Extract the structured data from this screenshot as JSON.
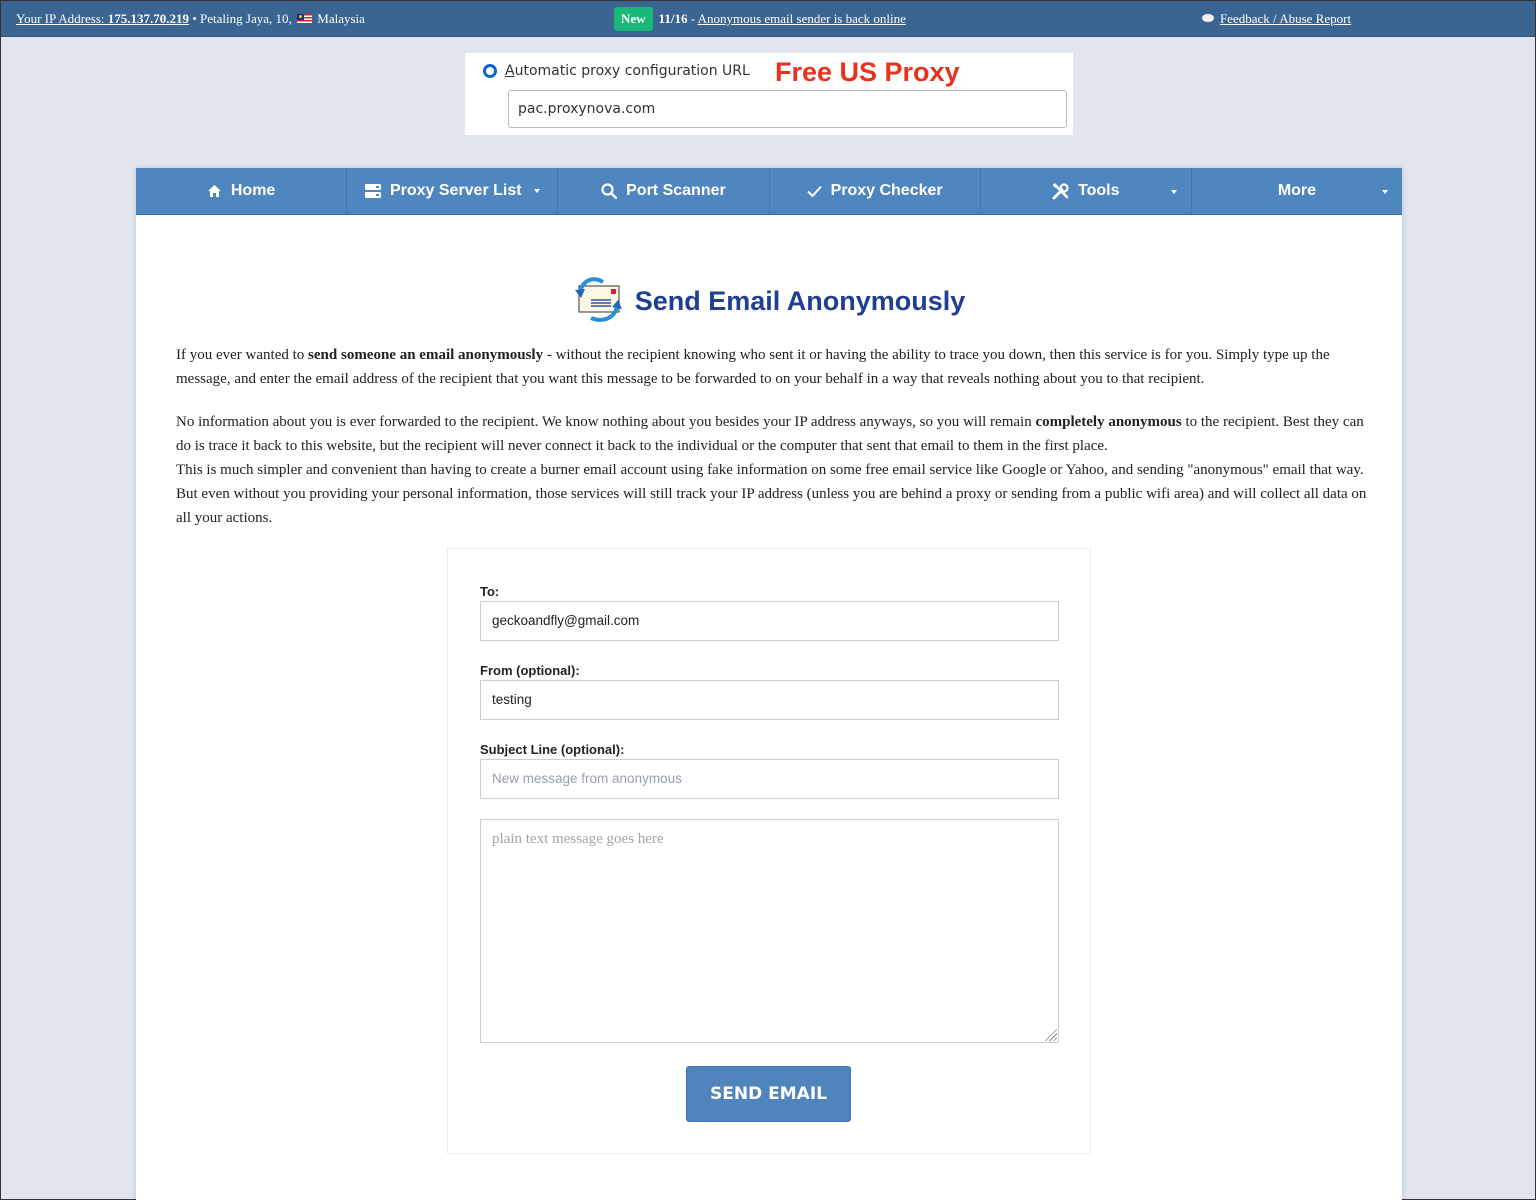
{
  "topbar": {
    "ip_label": "Your IP Address: ",
    "ip_value": "175.137.70.219",
    "location_prefix": " • Petaling Jaya, 10, ",
    "country": "Malaysia",
    "news_badge": "New",
    "news_date": "11/16",
    "news_separator": " - ",
    "news_link": "Anonymous email sender is back online",
    "feedback_link": "Feedback / Abuse Report"
  },
  "ad": {
    "radio_label_first": "A",
    "radio_label_rest": "utomatic proxy configuration URL",
    "promo_text": "Free US Proxy",
    "pac_url": "pac.proxynova.com"
  },
  "nav": {
    "items": [
      {
        "label": "Home",
        "icon": "home-icon"
      },
      {
        "label": "Proxy Server List",
        "icon": "server-icon",
        "dropdown": true
      },
      {
        "label": "Port Scanner",
        "icon": "search-icon"
      },
      {
        "label": "Proxy Checker",
        "icon": "check-icon"
      },
      {
        "label": "Tools",
        "icon": "tools-icon",
        "dropdown": true
      },
      {
        "label": "More",
        "dropdown": true
      }
    ]
  },
  "page": {
    "title": "Send Email Anonymously",
    "intro": {
      "p1_a": "If you ever wanted to ",
      "p1_bold": "send someone an email anonymously",
      "p1_b": " - without the recipient knowing who sent it or having the ability to trace you down, then this service is for you. Simply type up the message, and enter the email address of the recipient that you want this message to be forwarded to on your behalf in a way that reveals nothing about you to that recipient.",
      "p2_a": "No information about you is ever forwarded to the recipient. We know nothing about you besides your IP address anyways, so you will remain ",
      "p2_bold": "completely anonymous",
      "p2_b": " to the recipient. Best they can do is trace it back to this website, but the recipient will never connect it back to the individual or the computer that sent that email to them in the first place.",
      "p3": "This is much simpler and convenient than having to create a burner email account using fake information on some free email service like Google or Yahoo, and sending \"anonymous\" email that way. But even without you providing your personal information, those services will still track your IP address (unless you are behind a proxy or sending from a public wifi area) and will collect all data on all your actions."
    }
  },
  "form": {
    "to_label": "To:",
    "to_value": "geckoandfly@gmail.com",
    "from_label": "From (optional):",
    "from_value": "testing",
    "subject_label": "Subject Line (optional):",
    "subject_value": "",
    "subject_placeholder": "New message from anonymous",
    "message_value": "",
    "message_placeholder": "plain text message goes here",
    "submit_label": "SEND EMAIL"
  },
  "colors": {
    "topbar_bg": "#3a6592",
    "nav_bg": "#4f86bf",
    "title": "#1f4092",
    "badge_new": "#19b879",
    "promo": "#e8321e",
    "button": "#4f84bd"
  }
}
